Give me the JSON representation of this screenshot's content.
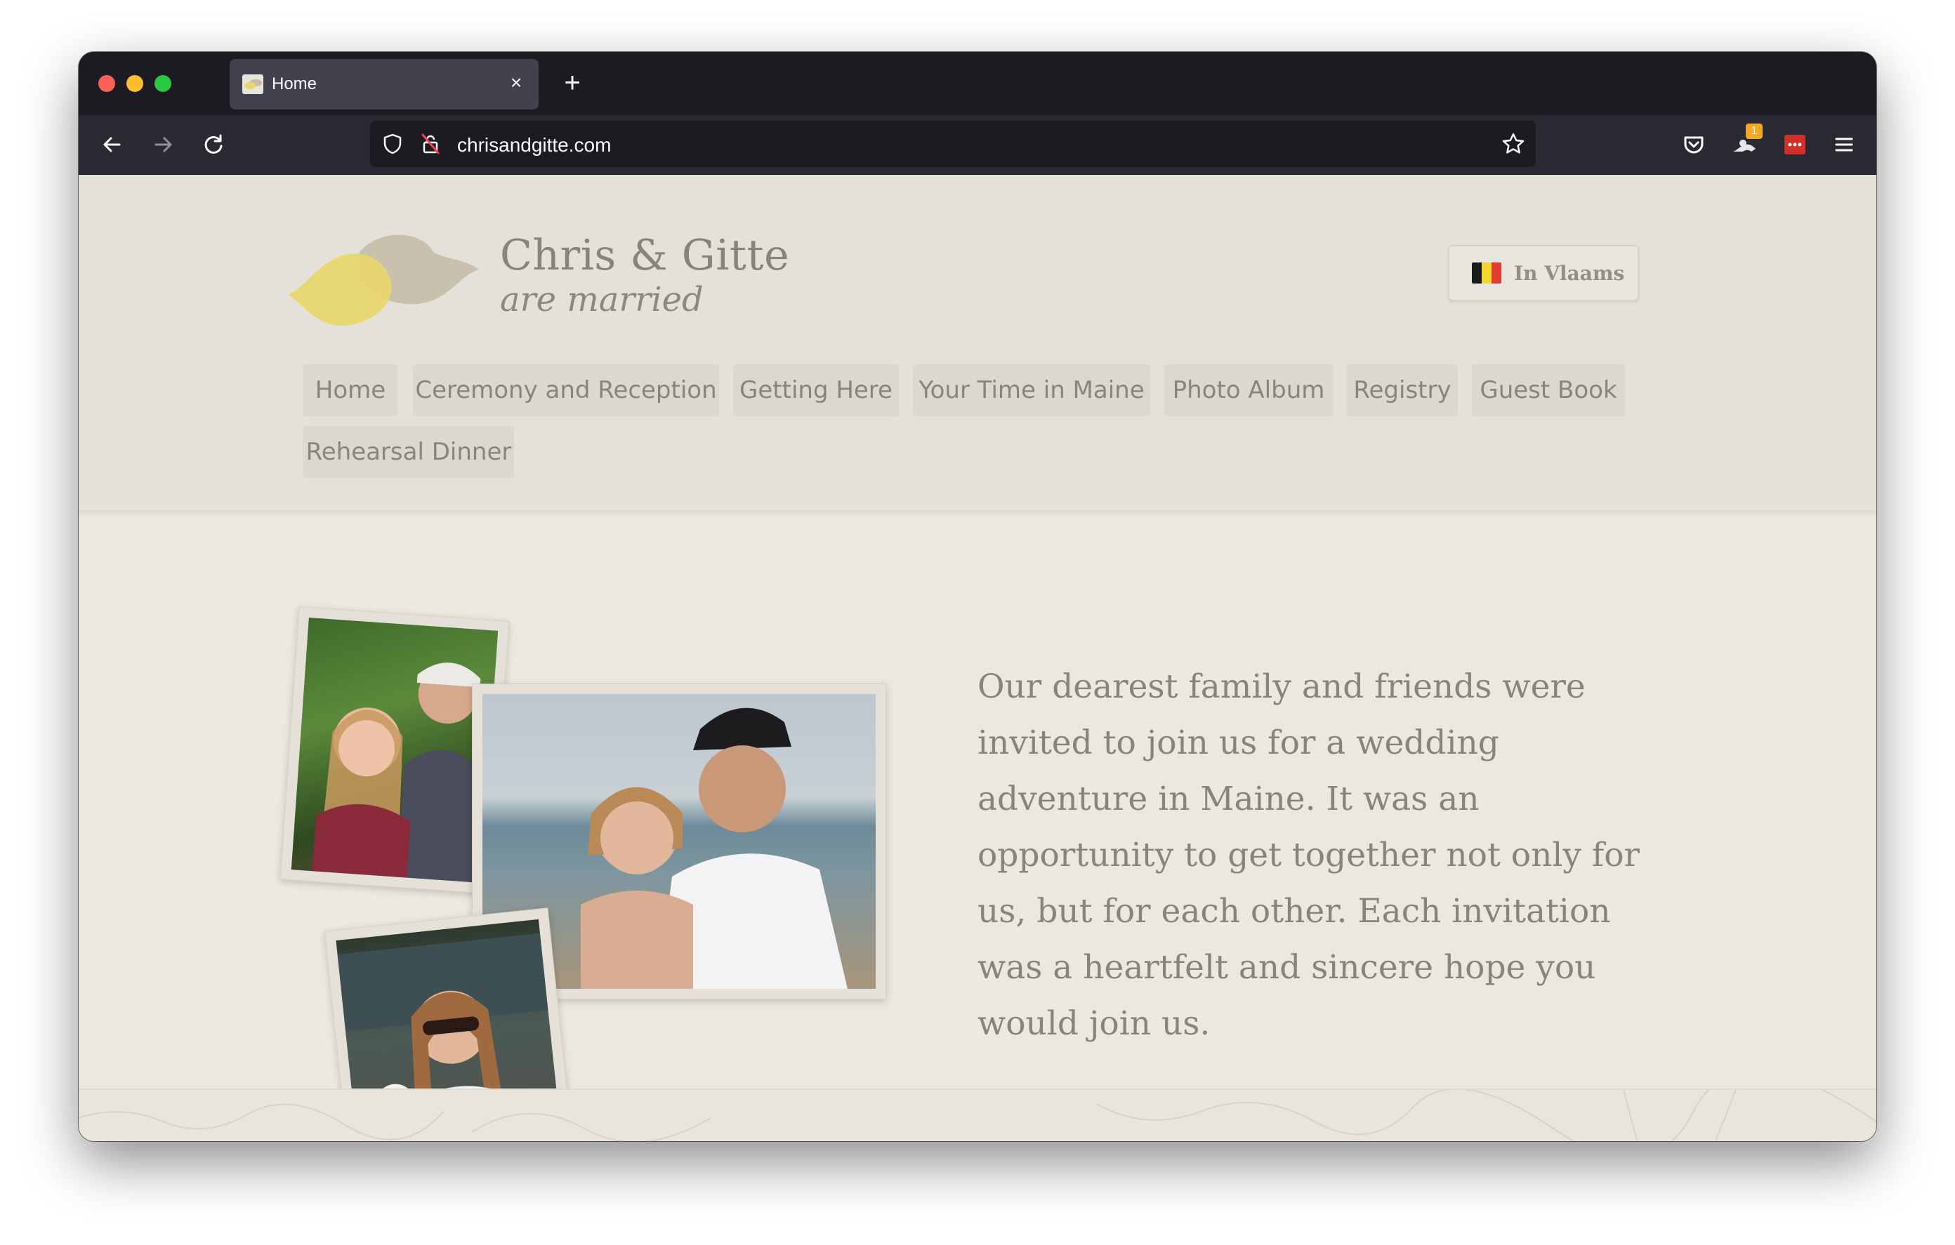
{
  "browser": {
    "tab_title": "Home",
    "url": "chrisandgitte.com",
    "extension_badge": "1"
  },
  "site": {
    "title": "Chris & Gitte",
    "subtitle": "are married",
    "language_button": "In Vlaams",
    "nav": [
      "Home",
      "Ceremony and Reception",
      "Getting Here",
      "Your Time in Maine",
      "Photo Album",
      "Registry",
      "Guest Book",
      "Rehearsal Dinner"
    ],
    "intro": "Our dearest family and friends were invited to join us for a wedding adventure in Maine. It was an opportunity to get together not only for us, but for each other. Each invitation was a heartfelt and sincere hope you would join us."
  },
  "colors": {
    "page_bg": "#ebe8e0",
    "text": "#8a8478",
    "nav_bg": "#dcd8cf",
    "bird_yellow": "#e8d76a",
    "bird_gray": "#c7bda8"
  }
}
